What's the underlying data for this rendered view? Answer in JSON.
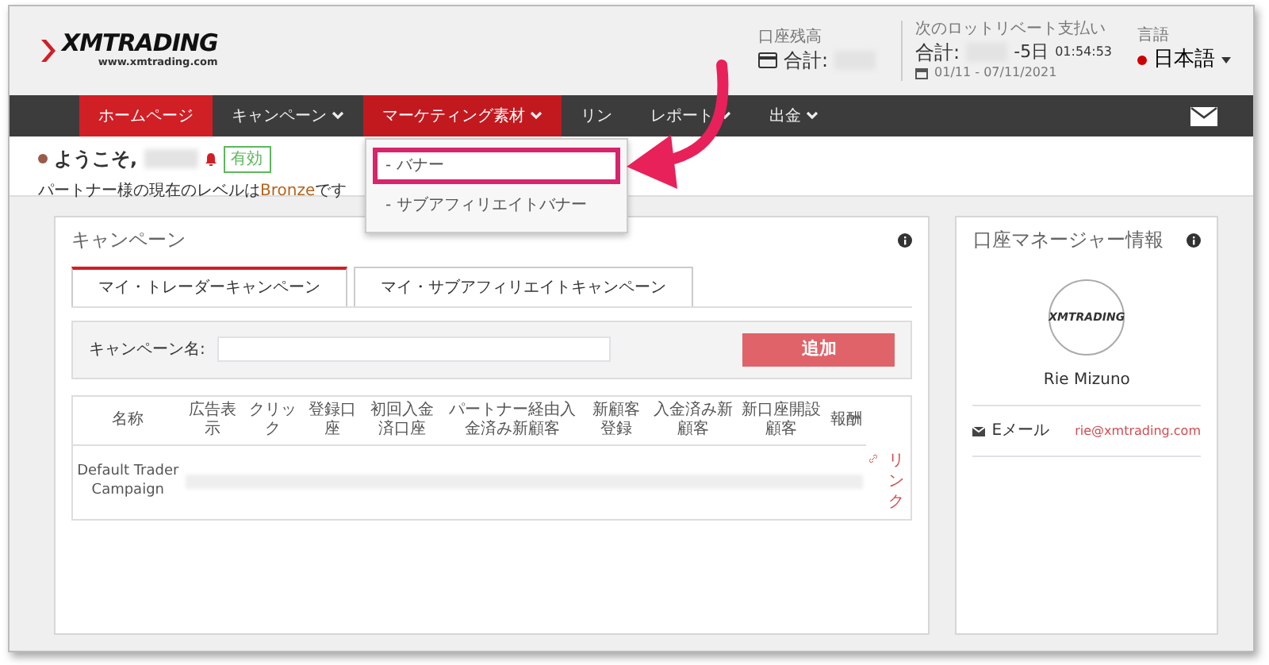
{
  "header": {
    "logo": {
      "text": "XMTRADING",
      "subtext": "www.xmtrading.com"
    },
    "balance": {
      "label": "口座残高",
      "total_label": "合計:"
    },
    "rebate": {
      "label": "次のロットリベート支払い",
      "total_label": "合計:",
      "days": "-5日",
      "time": "01:54:53",
      "period": "01/11 - 07/11/2021"
    },
    "language": {
      "label": "言語",
      "value": "日本語"
    }
  },
  "nav": [
    {
      "label": "ホームページ",
      "selected": true,
      "open": false,
      "caret": false
    },
    {
      "label": "キャンペーン",
      "selected": false,
      "open": false,
      "caret": true
    },
    {
      "label": "マーケティング素材",
      "selected": false,
      "open": true,
      "caret": true
    },
    {
      "label": "リン",
      "selected": false,
      "open": false,
      "caret": false
    },
    {
      "label": "レポート",
      "selected": false,
      "open": false,
      "caret": true
    },
    {
      "label": "出金",
      "selected": false,
      "open": false,
      "caret": true
    }
  ],
  "dropdown": [
    {
      "label": "- バナー",
      "highlighted": true
    },
    {
      "label": "- サブアフィリエイトバナー",
      "highlighted": false
    }
  ],
  "welcome": {
    "greeting": "ようこそ,",
    "status": "有効",
    "level_prefix": "パートナー様の現在のレベルは",
    "level": "Bronze",
    "level_suffix": "です"
  },
  "campaign_panel": {
    "title": "キャンペーン",
    "tabs": [
      {
        "label": "マイ・トレーダーキャンペーン",
        "selected": true
      },
      {
        "label": "マイ・サブアフィリエイトキャンペーン",
        "selected": false
      }
    ],
    "name_label": "キャンペーン名:",
    "add_button": "追加",
    "table": {
      "columns": [
        "名称",
        "広告表示",
        "クリック",
        "登録口座",
        "初回入金済口座",
        "パートナー経由入金済み新顧客",
        "新顧客登録",
        "入金済み新顧客",
        "新口座開設顧客",
        "報酬"
      ],
      "rows": [
        {
          "name": "Default Trader Campaign",
          "link": "リンク"
        }
      ]
    }
  },
  "manager_panel": {
    "title": "口座マネージャー情報",
    "logo": "XMTRADING",
    "name": "Rie Mizuno",
    "email_label": "Eメール",
    "email": "rie@xmtrading.com"
  }
}
